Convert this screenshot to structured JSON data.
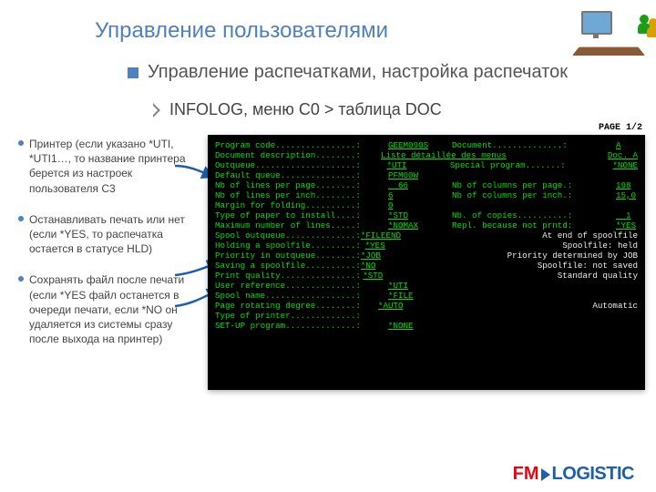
{
  "title": "Управление пользователями",
  "subtitle": "Управление распечатками, настройка распечаток",
  "breadcrumb": "INFOLOG, меню C0 > таблица DOC",
  "notes": [
    "Принтер (если указано *UTI, *UTI1…, то название принтера берется из настроек пользователя С3",
    "Останавливать печать или нет (если *YES, то распечатка остается в статусе HLD)",
    "Сохранять файл после печати (если *YES файл останется в очереди печати, если *NO он удаляется из системы сразу после выхода на принтер)"
  ],
  "page_tag": "PAGE 1/2",
  "terminal": {
    "rows": [
      {
        "k": "Program code................:",
        "v": "GEEM090S",
        "k2": "Document..............:",
        "v2": "A"
      },
      {
        "k": "Document description........:",
        "v": "Liste détaillée des menus",
        "k2": "",
        "v2": "Doc. A",
        "wide": true
      },
      {
        "k": "Outqueue....................:",
        "v": "*UTI",
        "k2": "Special program.......:",
        "v2": "*NONE"
      },
      {
        "k": "Default queue...............:",
        "v": "PFM00W",
        "k2": "",
        "v2": ""
      },
      {
        "k": "Nb of lines per page........:",
        "v": "  66",
        "k2": "Nb of columns per page.:",
        "v2": "198"
      },
      {
        "k": "Nb of lines per inch........:",
        "v": "6",
        "k2": "Nb of columns per inch.:",
        "v2": "15,0"
      },
      {
        "k": "Margin for folding..........:",
        "v": "0",
        "k2": "",
        "v2": ""
      },
      {
        "k": "Type of paper to install....:",
        "v": "*STD",
        "k2": "Nb. of copies..........:",
        "v2": "  1"
      },
      {
        "k": "Maximum number of lines.....:",
        "v": "*NOMAX",
        "k2": "Repl. because not prntd:",
        "v2": "*YES"
      },
      {
        "k": "Spool outqueue..............:",
        "v": "*FILEEND",
        "k2": "",
        "v2": "At end of spoolfile",
        "plain2": true
      },
      {
        "k": "Holding a spoolfile.........:",
        "v": "*YES",
        "k2": "",
        "v2": "Spoolfile: held",
        "plain2": true
      },
      {
        "k": "Priority in outqueue........:",
        "v": "*JOB",
        "k2": "",
        "v2": "Priority determined by JOB",
        "plain2": true
      },
      {
        "k": "Saving a spoolfile..........:",
        "v": "*NO",
        "k2": "",
        "v2": "Spoolfile: not saved",
        "plain2": true
      },
      {
        "k": "Print quality...............:",
        "v": "*STD",
        "k2": "",
        "v2": "Standard quality",
        "plain2": true
      },
      {
        "k": "User reference..............:",
        "v": "*UTI",
        "k2": "",
        "v2": ""
      },
      {
        "k": "Spool name..................:",
        "v": "*FILE",
        "k2": "",
        "v2": ""
      },
      {
        "k": "Page rotating degree........:",
        "v": "*AUTO",
        "k2": "",
        "v2": "Automatic",
        "plain2": true
      },
      {
        "k": "Type of printer.............:",
        "v": "",
        "k2": "",
        "v2": ""
      },
      {
        "k": "SET-UP program..............:",
        "v": "*NONE",
        "k2": "",
        "v2": ""
      }
    ]
  },
  "logo": {
    "fm": "FM",
    "log": "LOGISTIC"
  }
}
